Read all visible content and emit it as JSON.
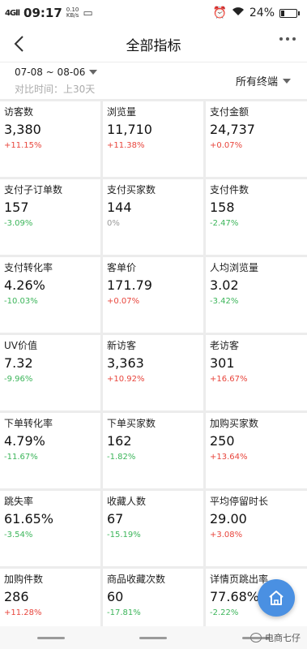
{
  "status_bar": {
    "signal": "4Gll",
    "time": "09:17",
    "speed_value": "0.10",
    "speed_unit": "KB/s",
    "mini_icon": "▭",
    "alarm_icon": "⏰",
    "wifi_icon": "wifi-icon",
    "battery": "24%",
    "battery_level": 0.24
  },
  "nav": {
    "title": "全部指标"
  },
  "filter": {
    "date_range": "07-08 ~ 08-06",
    "compare": "对比时间：上30天",
    "terminal": "所有终端"
  },
  "metrics": [
    {
      "label": "访客数",
      "value": "3,380",
      "change": "+11.15%",
      "trend": "up"
    },
    {
      "label": "浏览量",
      "value": "11,710",
      "change": "+11.38%",
      "trend": "up"
    },
    {
      "label": "支付金额",
      "value": "24,737",
      "change": "+0.07%",
      "trend": "up"
    },
    {
      "label": "支付子订单数",
      "value": "157",
      "change": "-3.09%",
      "trend": "down"
    },
    {
      "label": "支付买家数",
      "value": "144",
      "change": "0%",
      "trend": "flat"
    },
    {
      "label": "支付件数",
      "value": "158",
      "change": "-2.47%",
      "trend": "down"
    },
    {
      "label": "支付转化率",
      "value": "4.26%",
      "change": "-10.03%",
      "trend": "down"
    },
    {
      "label": "客单价",
      "value": "171.79",
      "change": "+0.07%",
      "trend": "up"
    },
    {
      "label": "人均浏览量",
      "value": "3.02",
      "change": "-3.42%",
      "trend": "down"
    },
    {
      "label": "UV价值",
      "value": "7.32",
      "change": "-9.96%",
      "trend": "down"
    },
    {
      "label": "新访客",
      "value": "3,363",
      "change": "+10.92%",
      "trend": "up"
    },
    {
      "label": "老访客",
      "value": "301",
      "change": "+16.67%",
      "trend": "up"
    },
    {
      "label": "下单转化率",
      "value": "4.79%",
      "change": "-11.67%",
      "trend": "down"
    },
    {
      "label": "下单买家数",
      "value": "162",
      "change": "-1.82%",
      "trend": "down"
    },
    {
      "label": "加购买家数",
      "value": "250",
      "change": "+13.64%",
      "trend": "up"
    },
    {
      "label": "跳失率",
      "value": "61.65%",
      "change": "-3.54%",
      "trend": "down"
    },
    {
      "label": "收藏人数",
      "value": "67",
      "change": "-15.19%",
      "trend": "down"
    },
    {
      "label": "平均停留时长",
      "value": "29.00",
      "change": "+3.08%",
      "trend": "up"
    },
    {
      "label": "加购件数",
      "value": "286",
      "change": "+11.28%",
      "trend": "up"
    },
    {
      "label": "商品收藏次数",
      "value": "60",
      "change": "-17.81%",
      "trend": "down"
    },
    {
      "label": "详情页跳出率",
      "value": "77.68%",
      "change": "-2.22%",
      "trend": "down"
    }
  ],
  "fab": {
    "icon": "home-icon"
  },
  "watermark": {
    "text": "电商七仔",
    "icon": "wechat-icon"
  },
  "colors": {
    "up": "#e8453c",
    "down": "#3cb55a",
    "flat": "#999999",
    "fab": "#4a90e2"
  }
}
